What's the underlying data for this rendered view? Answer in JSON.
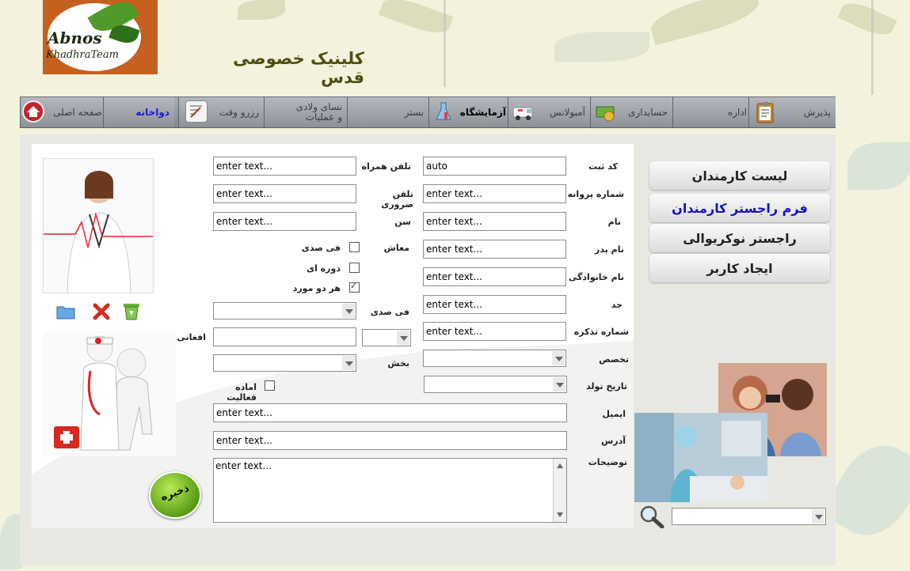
{
  "header": {
    "logo_text_1": "Abnos",
    "logo_text_2": "KhadhraTeam",
    "clinic_name": "کلینیک خصوصی قدس"
  },
  "nav": {
    "items": [
      {
        "label": "صفحه اصلی",
        "icon": "home-icon"
      },
      {
        "label": "دواخانه",
        "icon": "",
        "state": "active"
      },
      {
        "label": "رزرو وقت",
        "icon": "calendar-note-icon"
      },
      {
        "label_line1": "نسای ولادی",
        "label_line2": "و عملیات",
        "icon": ""
      },
      {
        "label": "بستر",
        "icon": ""
      },
      {
        "label": "آزمایشگاه",
        "icon": "flask-icon",
        "state": "bold"
      },
      {
        "label": "آمبولانس",
        "icon": "ambulance-icon"
      },
      {
        "label": "حسابداری",
        "icon": "cash-icon"
      },
      {
        "label": "اداره",
        "icon": ""
      },
      {
        "label": "پذیرش",
        "icon": "clipboard-icon"
      }
    ]
  },
  "form": {
    "labels": {
      "reg_code": "کد ثبت",
      "license_no": "شماره پروانه",
      "name": "نام",
      "father_name": "نام پدر",
      "family_name": "نام خانوادگی",
      "grandfather": "جد",
      "tazkira_no": "شماره تذکره",
      "specialty": "تخصص",
      "birth_date": "تاریخ تولد",
      "email": "ایمیل",
      "address": "آدرس",
      "description": "توضیحات",
      "companion_phone": "تلفن همراه",
      "emergency_phone": "تلفن ضروری",
      "age": "سن",
      "salary": "معاش",
      "percent": "فی صدی",
      "afghani": "افغانی",
      "department": "بخش"
    },
    "values": {
      "reg_code": "auto",
      "placeholder": "enter text..."
    },
    "salary_options": [
      {
        "label": "فی صدی",
        "checked": false
      },
      {
        "label": "دوره ای",
        "checked": false
      },
      {
        "label": "هر دو مورد",
        "checked": true
      }
    ],
    "active_ready": {
      "label": "اماده فعالیت",
      "checked": false
    },
    "save_label": "ذخیره"
  },
  "side_menu": [
    {
      "label": "لیست کارمندان",
      "state": ""
    },
    {
      "label": "فرم راجستر کارمندان",
      "state": "active"
    },
    {
      "label": "راجستر نوکریوالی",
      "state": ""
    },
    {
      "label": "ایجاد کاربر",
      "state": ""
    }
  ],
  "colors": {
    "accent_blue": "#1212c9",
    "save_green": "#5a9c16",
    "header_text": "#4f4e12"
  }
}
